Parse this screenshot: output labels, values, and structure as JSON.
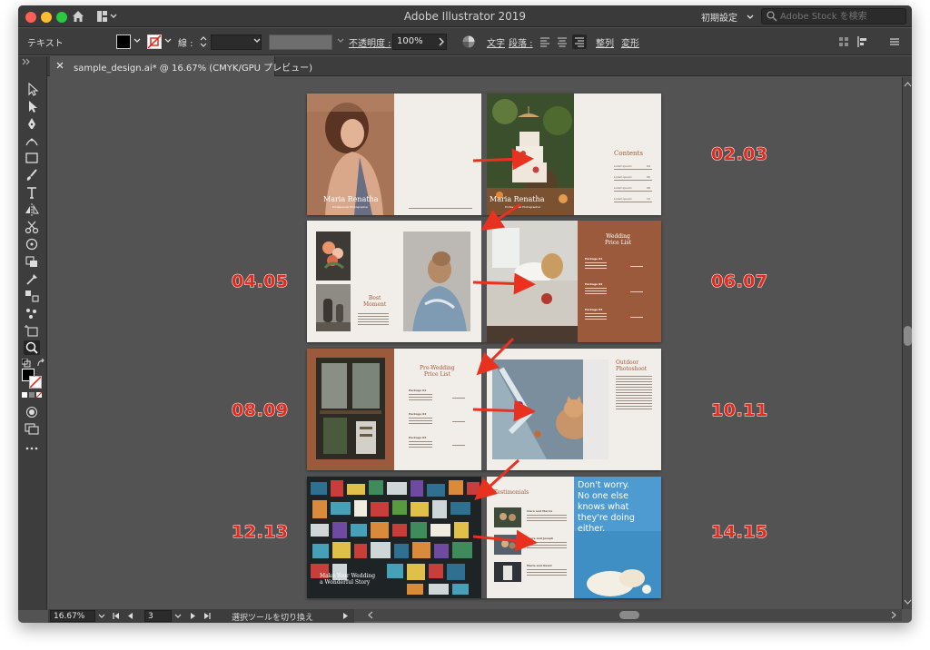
{
  "window": {
    "title": "Adobe Illustrator 2019"
  },
  "workspace": {
    "label": "初期設定"
  },
  "stock_search": {
    "placeholder": "Adobe Stock を検索"
  },
  "control_bar": {
    "selection_label": "テキスト",
    "stroke_label": "線 :",
    "opacity_label": "不透明度 :",
    "opacity_value": "100%",
    "character_label": "文字",
    "paragraph_label": "段落 :",
    "arrange_label": "整列",
    "transform_label": "変形"
  },
  "document_tab": {
    "label": "sample_design.ai* @ 16.67% (CMYK/GPU プレビュー)"
  },
  "status_bar": {
    "zoom": "16.67%",
    "artboard_number": "3",
    "status_text": "選択ツールを切り換え"
  },
  "spread_labels": {
    "s1": "02.03",
    "s2": "04.05",
    "s3": "06.07",
    "s4": "08.09",
    "s5": "10.11",
    "s6": "12.13",
    "s7": "14.15"
  },
  "artwork": {
    "cover_title": "Maria Renatha",
    "cover_subtitle": "Professional Photographer",
    "cover_title_overlay": "Maria Renatha",
    "cover_subtitle_overlay": "Professional Photographer",
    "contents_title": "Contents",
    "contents_items": [
      "Lorem Ipsum",
      "Lorem Ipsum",
      "Lorem Ipsum",
      "Lorem Ipsum"
    ],
    "contents_pages": [
      "04",
      "06",
      "08",
      "10"
    ],
    "best_moment": "Best\nMoment",
    "wedding_price_title": "Wedding\nPrice List",
    "wedding_packages": [
      "Package 01",
      "Package 02",
      "Package 03"
    ],
    "pre_wedding_title": "Pre-Wedding\nPrice List",
    "pre_wedding_packages": [
      "Package 01",
      "Package 02",
      "Package 03"
    ],
    "outdoor_title": "Outdoor\nPhotoshoot",
    "wedding_story": "Make Your Wedding\na Wonderful Story",
    "testimonials_title": "Testimonials",
    "testimonial_names": [
      "Clara and Marcis",
      "Laura and Joseph",
      "Maria and David"
    ],
    "quote": "Don't worry.\nNo one else\nknows what\nthey're doing\neither."
  },
  "colors": {
    "accent_red": "#e02d1f",
    "rust": "#9c5a3c",
    "paper": "#f1ede8",
    "canvas": "#535353",
    "chrome": "#3d3d3d"
  }
}
